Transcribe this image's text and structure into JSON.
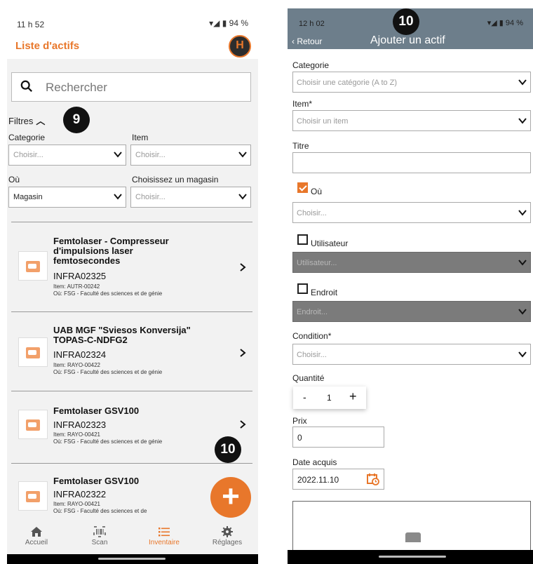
{
  "left": {
    "status": {
      "time": "11 h 52",
      "battery": "94 %"
    },
    "app_title": "Liste d'actifs",
    "logo_letter": "H",
    "search": {
      "placeholder": "Rechercher"
    },
    "filters": {
      "label": "Filtres",
      "badge": "9",
      "category": {
        "label": "Categorie",
        "value": "Choisir..."
      },
      "item": {
        "label": "Item",
        "value": "Choisir..."
      },
      "where": {
        "label": "Où",
        "value": "Magasin"
      },
      "store": {
        "label": "Choisissez un magasin",
        "value": "Choisir..."
      }
    },
    "assets": [
      {
        "name": "Femtolaser - Compresseur d'impulsions laser femtosecondes",
        "code": "INFRA02325",
        "item": "Item: AUTR-00242",
        "where": "Où: FSG - Faculté des sciences et de génie"
      },
      {
        "name": "UAB MGF \"Sviesos Konversija\" TOPAS-C-NDFG2",
        "code": "INFRA02324",
        "item": "Item: RAYO-00422",
        "where": "Où: FSG - Faculté des sciences et de génie"
      },
      {
        "name": "Femtolaser GSV100",
        "code": "INFRA02323",
        "item": "Item: RAYO-00421",
        "where": "Où: FSG - Faculté des sciences et de génie"
      },
      {
        "name": "Femtolaser GSV100",
        "code": "INFRA02322",
        "item": "Item: RAYO-00421",
        "where": "Où: FSG - Faculté des sciences et de"
      }
    ],
    "fab_badge": "10",
    "nav": [
      {
        "label": "Accueil",
        "icon": "home-icon"
      },
      {
        "label": "Scan",
        "icon": "barcode-icon"
      },
      {
        "label": "Inventaire",
        "icon": "list-icon"
      },
      {
        "label": "Réglages",
        "icon": "gear-icon"
      }
    ],
    "accent": "#e8772b"
  },
  "right": {
    "status": {
      "time": "12 h 02",
      "battery": "94 %"
    },
    "badge": "10",
    "back_label": "Retour",
    "title": "Ajouter un actif",
    "category": {
      "label": "Categorie",
      "placeholder": "Choisir une catégorie (A to Z)"
    },
    "item": {
      "label": "Item*",
      "placeholder": "Choisir un item"
    },
    "titre": {
      "label": "Titre",
      "value": ""
    },
    "where": {
      "label": "Où",
      "checked": true,
      "placeholder": "Choisir..."
    },
    "user": {
      "label": "Utilisateur",
      "checked": false,
      "placeholder": "Utilisateur..."
    },
    "place": {
      "label": "Endroit",
      "checked": false,
      "placeholder": "Endroit..."
    },
    "condition": {
      "label": "Condition*",
      "placeholder": "Choisir..."
    },
    "quantity": {
      "label": "Quantité",
      "minus": "-",
      "value": "1",
      "plus": "+"
    },
    "price": {
      "label": "Prix",
      "value": "0"
    },
    "date": {
      "label": "Date acquis",
      "value": "2022.11.10"
    }
  }
}
